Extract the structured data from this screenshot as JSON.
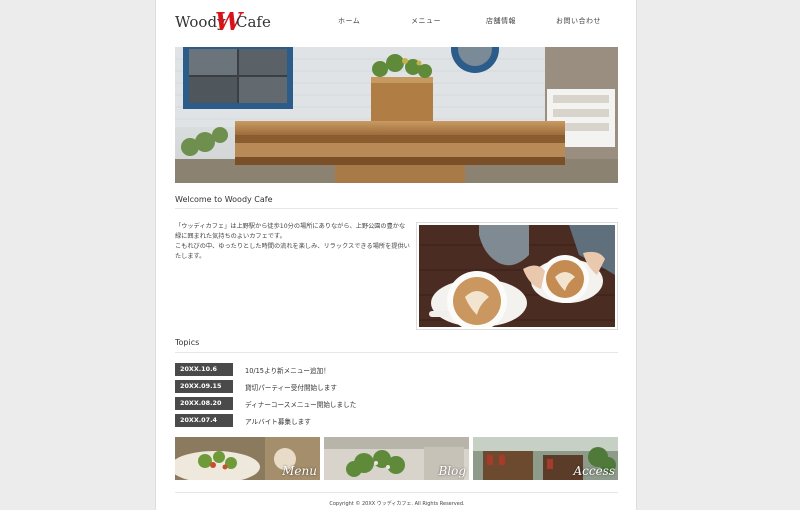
{
  "header": {
    "logo_left": "Woody",
    "logo_mark": "W",
    "logo_right": "Cafe"
  },
  "nav": {
    "items": [
      {
        "label": "ホーム"
      },
      {
        "label": "メニュー"
      },
      {
        "label": "店舗情報"
      },
      {
        "label": "お問い合わせ"
      }
    ]
  },
  "welcome": {
    "title": "Welcome to Woody Cafe",
    "paragraph1": "「ウッディカフェ」は上野駅から徒歩10分の場所にありながら、上野公園の豊かな緑に囲まれた気持ちのよいカフェです。",
    "paragraph2": "こもれびの中、ゆったりとした時間の流れを楽しみ、リラックスできる場所を提供いたします。"
  },
  "topics": {
    "title": "Topics",
    "items": [
      {
        "date": "20XX.10.6",
        "text": "10/15より新メニュー追加！"
      },
      {
        "date": "20XX.09.15",
        "text": "貸切パーティー受付開始します"
      },
      {
        "date": "20XX.08.20",
        "text": "ディナーコースメニュー開始しました"
      },
      {
        "date": "20XX.07.4",
        "text": "アルバイト募集します"
      }
    ]
  },
  "banners": [
    {
      "label": "Menu"
    },
    {
      "label": "Blog"
    },
    {
      "label": "Access"
    }
  ],
  "footer": {
    "copyright": "Copyright © 20XX ウッディカフェ. All Rights Reserved."
  },
  "colors": {
    "accent": "#d7141a",
    "date_badge": "#4a4a4a",
    "page_bg": "#ececec"
  }
}
